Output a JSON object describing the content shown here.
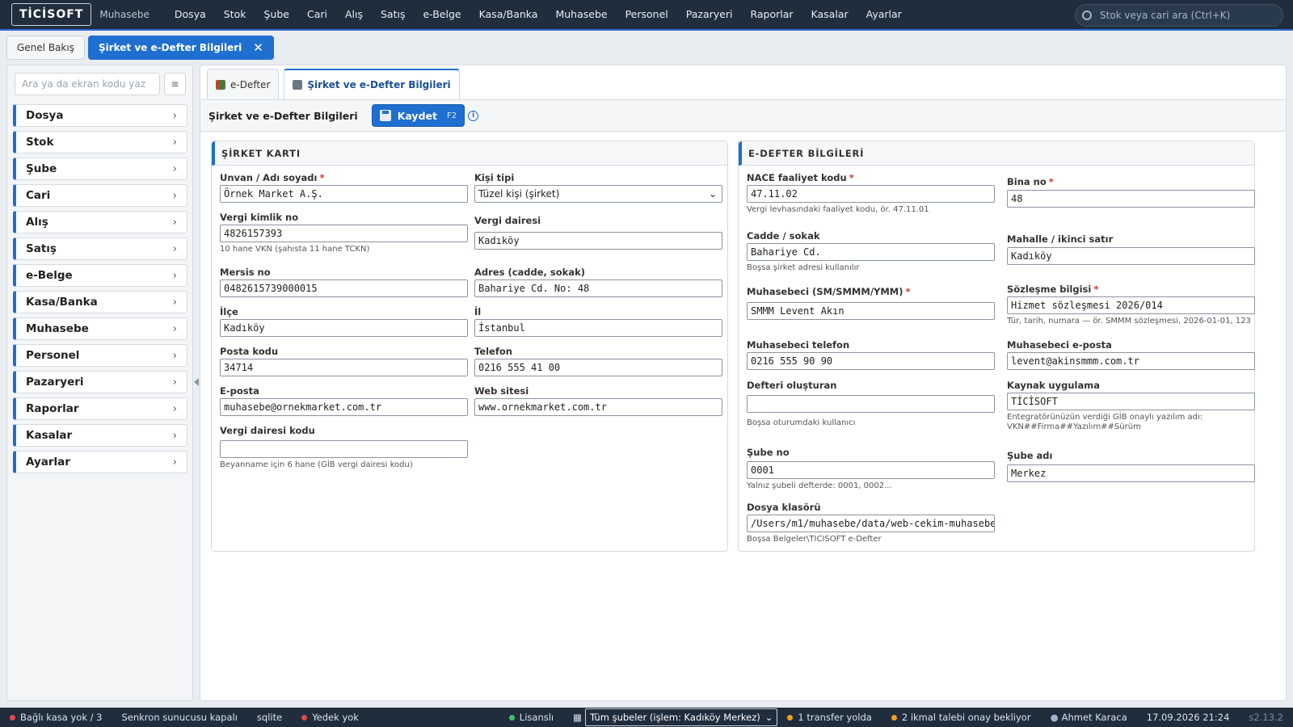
{
  "topbar": {
    "logo": "TİCİSOFT",
    "subtitle": "Muhasebe",
    "menu": [
      "Dosya",
      "Stok",
      "Şube",
      "Cari",
      "Alış",
      "Satış",
      "e-Belge",
      "Kasa/Banka",
      "Muhasebe",
      "Personel",
      "Pazaryeri",
      "Raporlar",
      "Kasalar",
      "Ayarlar"
    ],
    "search_placeholder": "Stok veya cari ara (Ctrl+K)"
  },
  "page_tabs": {
    "tab1": "Genel Bakış",
    "tab2": "Şirket ve e-Defter Bilgileri",
    "close": "✕"
  },
  "sidebar": {
    "search_placeholder": "Ara ya da ekran kodu yaz",
    "menu_button": "≡",
    "items": [
      "Dosya",
      "Stok",
      "Şube",
      "Cari",
      "Alış",
      "Satış",
      "e-Belge",
      "Kasa/Banka",
      "Muhasebe",
      "Personel",
      "Pazaryeri",
      "Raporlar",
      "Kasalar",
      "Ayarlar"
    ]
  },
  "subtabs": {
    "tab1": "e-Defter",
    "tab2": "Şirket ve e-Defter Bilgileri"
  },
  "toolbar": {
    "title": "Şirket ve e-Defter Bilgileri",
    "save": "Kaydet",
    "save_key": "F2",
    "info": "i"
  },
  "company": {
    "title": "ŞİRKET KARTI",
    "unvan_label": "Unvan / Adı soyadı",
    "unvan": "Örnek Market A.Ş.",
    "kisi_label": "Kişi tipi",
    "kisi": "Tüzel kişi (şirket)",
    "vkn_label": "Vergi kimlik no",
    "vkn": "4826157393",
    "vkn_hint": "10 hane VKN (şahısta 11 hane TCKN)",
    "vd_label": "Vergi dairesi",
    "vd": "Kadıköy",
    "mersis_label": "Mersis no",
    "mersis": "0482615739000015",
    "adres_label": "Adres (cadde, sokak)",
    "adres": "Bahariye Cd. No: 48",
    "ilce_label": "İlçe",
    "ilce": "Kadıköy",
    "il_label": "İl",
    "il": "İstanbul",
    "posta_label": "Posta kodu",
    "posta": "34714",
    "tel_label": "Telefon",
    "tel": "0216 555 41 00",
    "eposta_label": "E-posta",
    "eposta": "muhasebe@ornekmarket.com.tr",
    "web_label": "Web sitesi",
    "web": "www.ornekmarket.com.tr",
    "vdkod_label": "Vergi dairesi kodu",
    "vdkod": "",
    "vdkod_hint": "Beyanname için 6 hane (GİB vergi dairesi kodu)"
  },
  "edefter": {
    "title": "E-DEFTER BİLGİLERİ",
    "nace_label": "NACE faaliyet kodu",
    "nace": "47.11.02",
    "nace_hint": "Vergi levhasındaki faaliyet kodu, ör. 47.11.01",
    "bina_label": "Bina no",
    "bina": "48",
    "cadde_label": "Cadde / sokak",
    "cadde": "Bahariye Cd.",
    "cadde_hint": "Boşsa şirket adresi kullanılır",
    "mahalle_label": "Mahalle / ikinci satır",
    "mahalle": "Kadıköy",
    "muh_label": "Muhasebeci (SM/SMMM/YMM)",
    "muh": "SMMM Levent Akın",
    "sozlesme_label": "Sözleşme bilgisi",
    "sozlesme": "Hizmet sözleşmesi 2026/014",
    "sozlesme_hint": "Tür, tarih, numara — ör. SMMM sözleşmesi, 2026-01-01, 123",
    "muhtel_label": "Muhasebeci telefon",
    "muhtel": "0216 555 90 90",
    "muhmail_label": "Muhasebeci e-posta",
    "muhmail": "levent@akinsmmm.com.tr",
    "olusturan_label": "Defteri oluşturan",
    "olusturan": "",
    "olusturan_hint": "Boşsa oturumdaki kullanıcı",
    "kaynak_label": "Kaynak uygulama",
    "kaynak": "TİCİSOFT",
    "kaynak_hint1": "Entegratörünüzün verdiği GİB onaylı yazılım adı:",
    "kaynak_hint2": "VKN##Firma##Yazılım##Sürüm",
    "subeno_label": "Şube no",
    "subeno": "0001",
    "subeno_hint": "Yalnız şubeli defterde: 0001, 0002...",
    "subeadi_label": "Şube adı",
    "subeadi": "Merkez",
    "klasor_label": "Dosya klasörü",
    "klasor": "/Users/m1/muhasebe/data/web-cekim-muhasebe",
    "klasor_hint": "Boşsa Belgeler\\TICISOFT e-Defter"
  },
  "statusbar": {
    "kasa": "Bağlı kasa yok / 3",
    "senkron": "Senkron sunucusu kapalı",
    "db": "sqlite",
    "yedek": "Yedek yok",
    "lisans": "Lisanslı",
    "sube_select": "Tüm şubeler (işlem: Kadıköy Merkez)",
    "transfer": "1 transfer yolda",
    "ikmal": "2 ikmal talebi onay bekliyor",
    "user": "Ahmet Karaca",
    "datetime": "17.09.2026 21:24",
    "version": "s2.13.2"
  },
  "colors": {
    "accent": "#1e6fd0",
    "topbar": "#1f2d3d",
    "required": "#d33333"
  }
}
